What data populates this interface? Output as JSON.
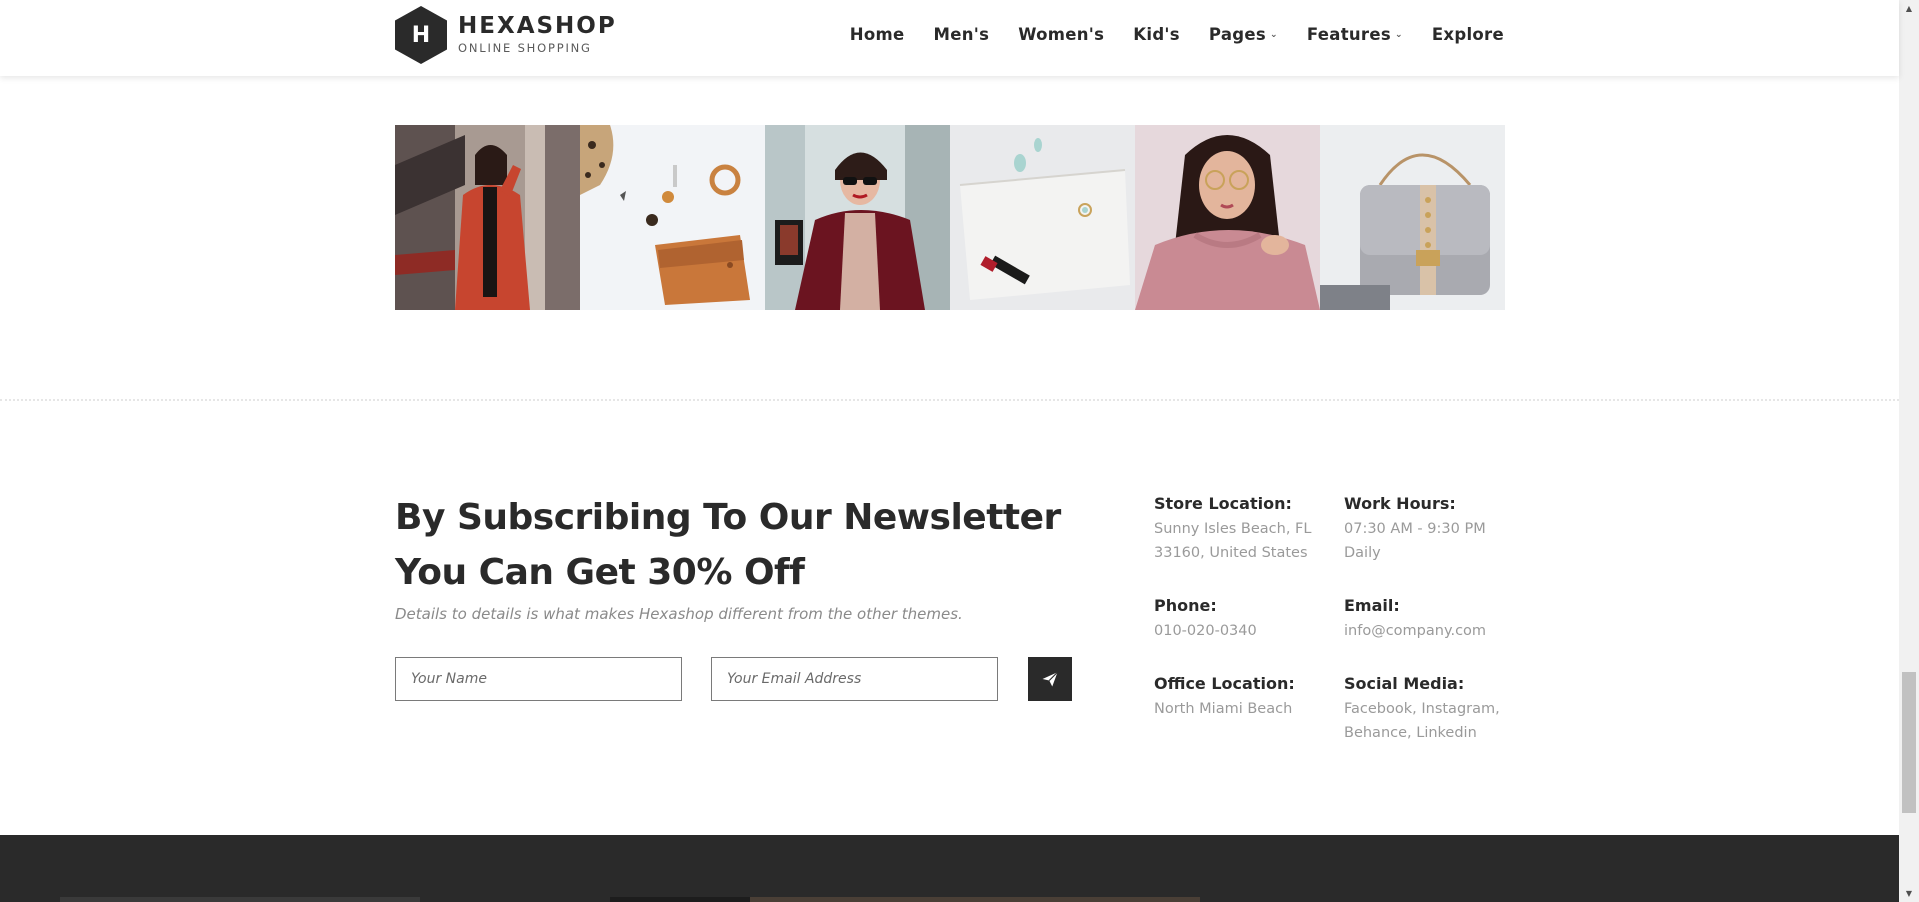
{
  "header": {
    "logo_letter": "H",
    "logo_title": "HEXASHOP",
    "logo_subtitle": "ONLINE SHOPPING",
    "nav": [
      {
        "label": "Home",
        "dropdown": false
      },
      {
        "label": "Men's",
        "dropdown": false
      },
      {
        "label": "Women's",
        "dropdown": false
      },
      {
        "label": "Kid's",
        "dropdown": false
      },
      {
        "label": "Pages",
        "dropdown": true
      },
      {
        "label": "Features",
        "dropdown": true
      },
      {
        "label": "Explore",
        "dropdown": false
      }
    ]
  },
  "gallery": {
    "items": [
      {
        "name": "woman-red-coat"
      },
      {
        "name": "leather-wallet-flatlay"
      },
      {
        "name": "woman-sunglasses"
      },
      {
        "name": "jewelry-pouch-lipstick"
      },
      {
        "name": "woman-pink-blouse"
      },
      {
        "name": "grey-studded-handbag"
      }
    ]
  },
  "newsletter": {
    "title": "By Subscribing To Our Newsletter You Can Get 30% Off",
    "description": "Details to details is what makes Hexashop different from the other themes.",
    "name_placeholder": "Your Name",
    "email_placeholder": "Your Email Address",
    "submit_icon": "paper-plane-icon"
  },
  "info": {
    "store_location": {
      "label": "Store Location:",
      "lines": [
        "Sunny Isles Beach, FL",
        "33160, United States"
      ]
    },
    "work_hours": {
      "label": "Work Hours:",
      "lines": [
        "07:30 AM - 9:30 PM",
        "Daily"
      ]
    },
    "phone": {
      "label": "Phone:",
      "lines": [
        "010-020-0340"
      ]
    },
    "email": {
      "label": "Email:",
      "lines": [
        "info@company.com"
      ]
    },
    "office_location": {
      "label": "Office Location:",
      "lines": [
        "North Miami Beach"
      ]
    },
    "social_media": {
      "label": "Social Media:",
      "lines": [
        "Facebook, Instagram,",
        "Behance, Linkedin"
      ]
    }
  },
  "colors": {
    "dark": "#2a2a2a",
    "muted_text": "#9a9a9a",
    "background": "#ffffff"
  }
}
